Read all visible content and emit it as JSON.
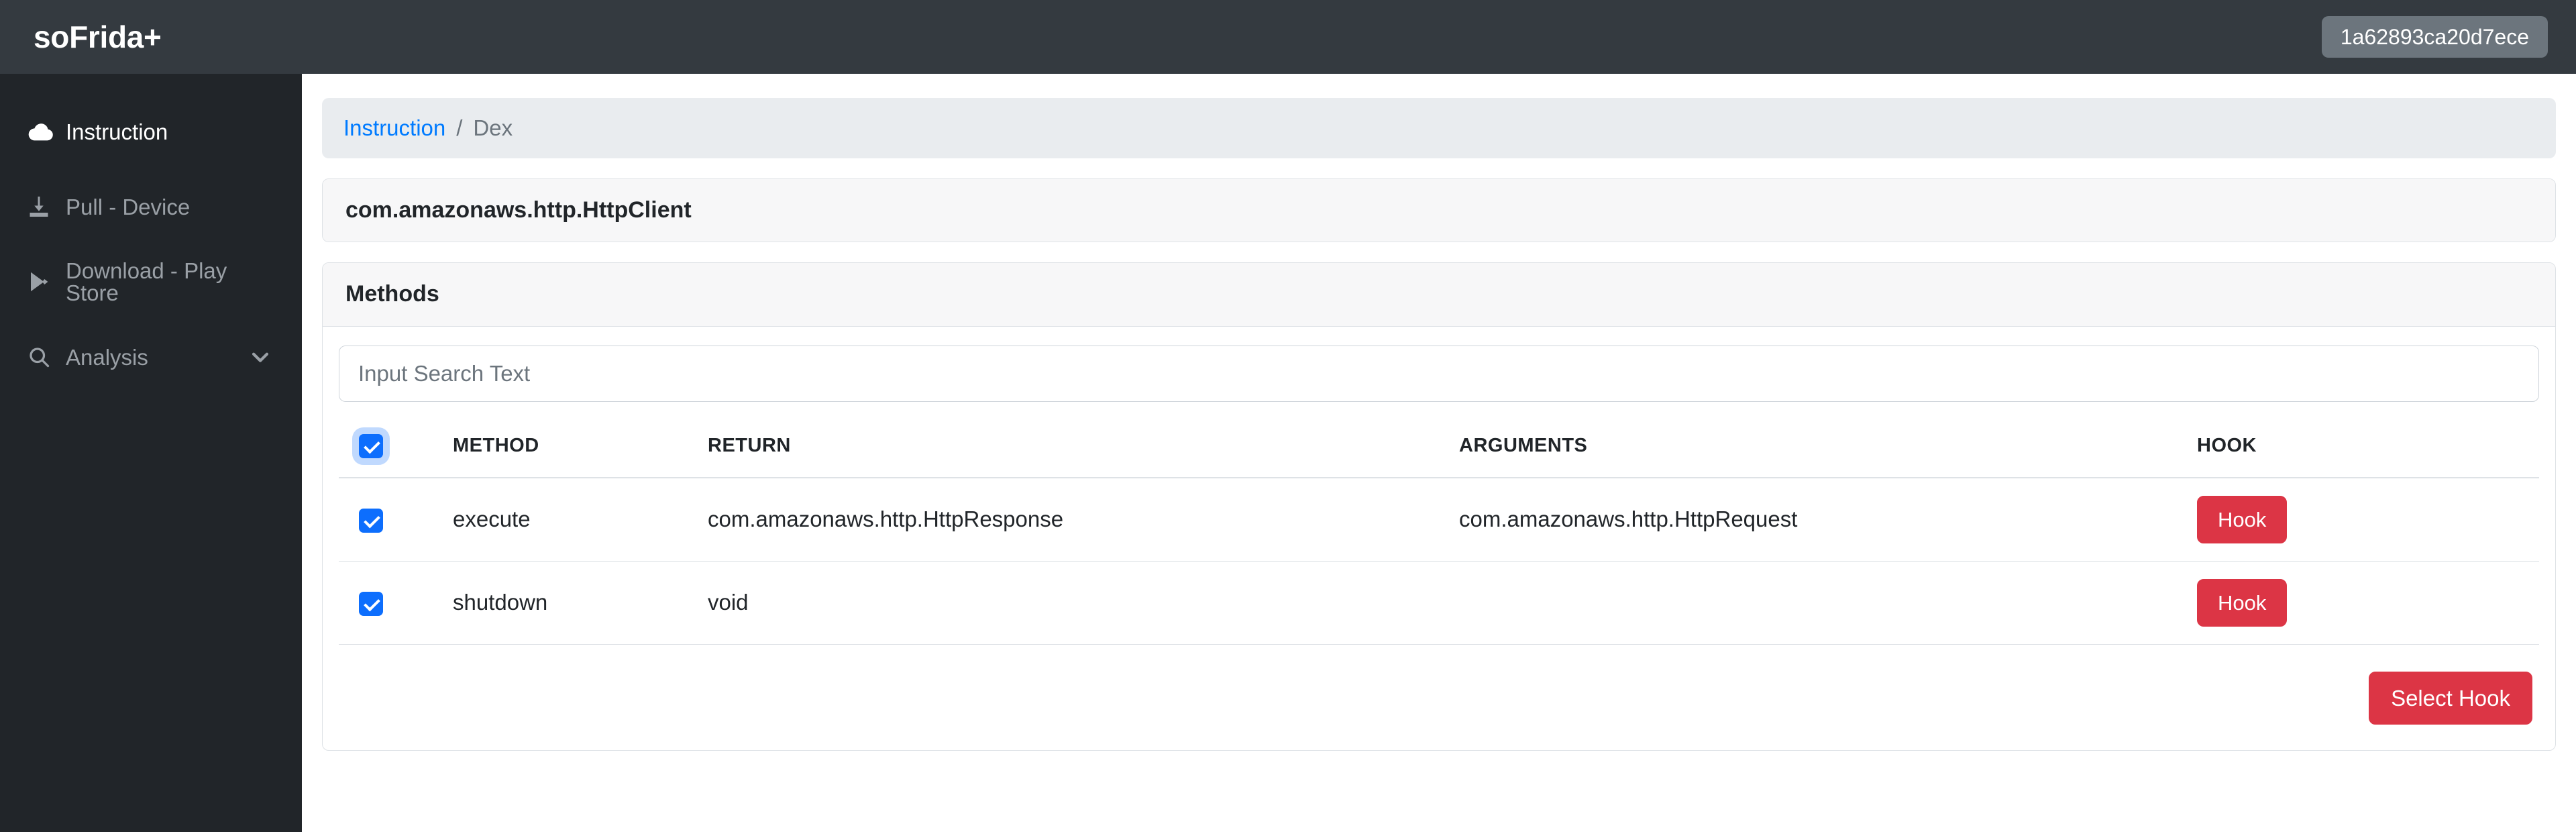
{
  "header": {
    "brand": "soFrida+",
    "device_badge": "1a62893ca20d7ece"
  },
  "sidebar": {
    "items": [
      {
        "label": "Instruction",
        "icon": "cloud-icon",
        "active": true
      },
      {
        "label": "Pull - Device",
        "icon": "download-icon",
        "active": false
      },
      {
        "label": "Download - Play Store",
        "icon": "play-store-icon",
        "active": false
      },
      {
        "label": "Analysis",
        "icon": "search-icon",
        "active": false,
        "chevron": "chevron-down-icon"
      }
    ]
  },
  "breadcrumb": {
    "root": "Instruction",
    "separator": "/",
    "current": "Dex"
  },
  "class_card": {
    "title": "com.amazonaws.http.HttpClient"
  },
  "methods_card": {
    "title": "Methods",
    "search": {
      "placeholder": "Input Search Text",
      "value": ""
    },
    "columns": [
      "METHOD",
      "RETURN",
      "ARGUMENTS",
      "HOOK"
    ],
    "select_all_checked": true,
    "rows": [
      {
        "checked": true,
        "method": "execute",
        "return": "com.amazonaws.http.HttpResponse",
        "arguments": "com.amazonaws.http.HttpRequest",
        "hook_label": "Hook"
      },
      {
        "checked": true,
        "method": "shutdown",
        "return": "void",
        "arguments": "",
        "hook_label": "Hook"
      }
    ],
    "select_hook_label": "Select Hook"
  },
  "colors": {
    "topbar": "#343a40",
    "sidebar": "#212529",
    "accent_link": "#007bff",
    "checkbox": "#0d6efd",
    "danger": "#dc3545",
    "badge": "#6c757d",
    "breadcrumb_bg": "#e9ecef"
  }
}
